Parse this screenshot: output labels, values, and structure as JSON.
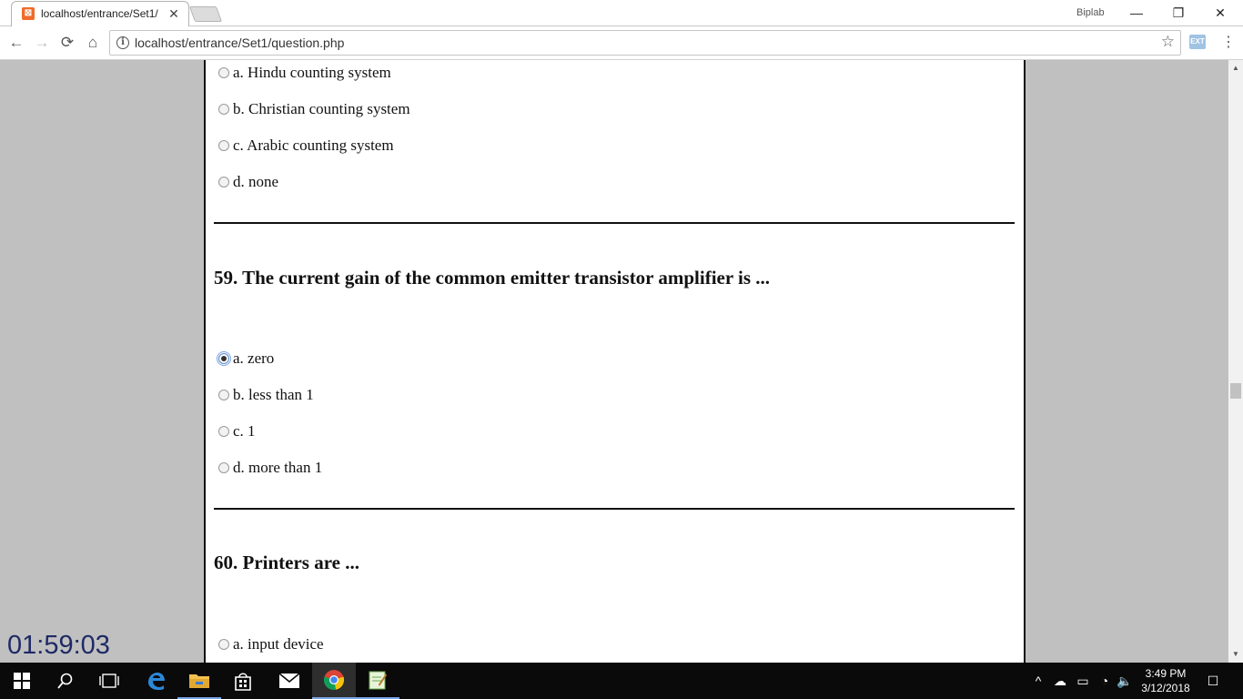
{
  "browser": {
    "tab": {
      "title": "localhost/entrance/Set1/",
      "close": "✕",
      "favicon": "⊠"
    },
    "profile": "Biplab",
    "window": {
      "minimize": "—",
      "restore": "❐",
      "close": "✕"
    },
    "nav": {
      "back": "←",
      "forward": "→",
      "reload": "⟳",
      "home": "⌂"
    },
    "url": "localhost/entrance/Set1/question.php",
    "info_icon": "i",
    "star_icon": "☆",
    "extension_label": "EXT",
    "menu": "⋮"
  },
  "quiz": {
    "top_options": [
      {
        "label": "a. Hindu counting system",
        "checked": false
      },
      {
        "label": "b. Christian counting system",
        "checked": false
      },
      {
        "label": "c. Arabic counting system",
        "checked": false
      },
      {
        "label": "d. none",
        "checked": false
      }
    ],
    "questions": [
      {
        "title": "59. The current gain of the common emitter transistor amplifier is ...",
        "options": [
          {
            "label": "a. zero",
            "checked": true
          },
          {
            "label": "b. less than 1",
            "checked": false
          },
          {
            "label": "c. 1",
            "checked": false
          },
          {
            "label": "d. more than 1",
            "checked": false
          }
        ]
      },
      {
        "title": "60. Printers are ...",
        "options": [
          {
            "label": "a. input device",
            "checked": false
          }
        ]
      }
    ],
    "timer": "01:59:03"
  },
  "scrollbar": {
    "up": "▲",
    "down": "▼"
  },
  "taskbar": {
    "start": "⊞",
    "search": "⌕",
    "task_view": "❐",
    "tray": {
      "chevron": "^",
      "cloud": "☁",
      "battery": "▭",
      "wifi": "◔",
      "volume": "🔈",
      "notifications": "☐"
    },
    "clock": {
      "time": "3:49 PM",
      "date": "3/12/2018"
    }
  },
  "colors": {
    "page_bg": "#c0c0c0",
    "timer": "#1f2a66",
    "taskbar": "#0a0a0a"
  }
}
